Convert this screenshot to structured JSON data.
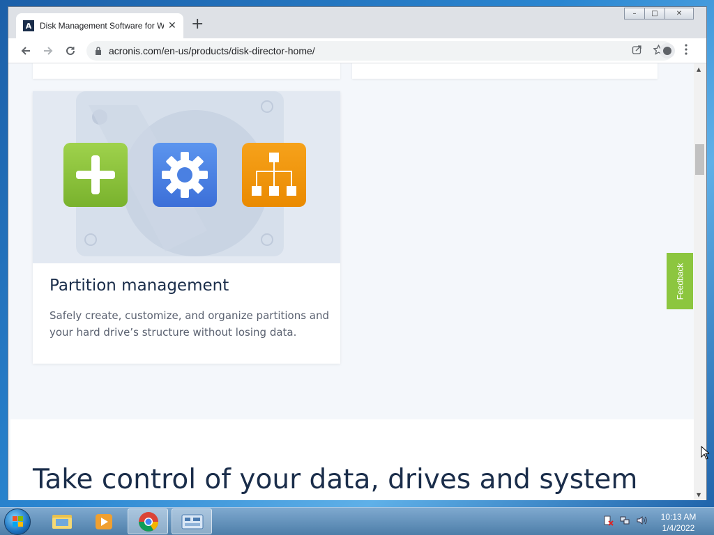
{
  "browser": {
    "tab_title": "Disk Management Software for W",
    "tab_favicon_letter": "A",
    "new_tab": "+",
    "tab_close": "✕",
    "url": "acronis.com/en-us/products/disk-director-home/",
    "window_controls": {
      "minimize": "–",
      "maximize": "□",
      "close": "✕"
    }
  },
  "page": {
    "card": {
      "title": "Partition management",
      "description": "Safely create, customize, and organize partitions and your hard drive’s structure without losing data.",
      "tile_colors": [
        "#8cc63f",
        "#4a86e8",
        "#f29200"
      ]
    },
    "heading": "Take control of your data, drives and system",
    "feedback_label": "Feedback",
    "colors": {
      "heading": "#1a2d4a",
      "feedback": "#8cc63f",
      "background": "#f4f7fb"
    }
  },
  "taskbar": {
    "time": "10:13 AM",
    "date": "1/4/2022",
    "items": [
      "explorer-icon",
      "media-player-icon",
      "chrome-icon",
      "control-panel-icon"
    ]
  }
}
